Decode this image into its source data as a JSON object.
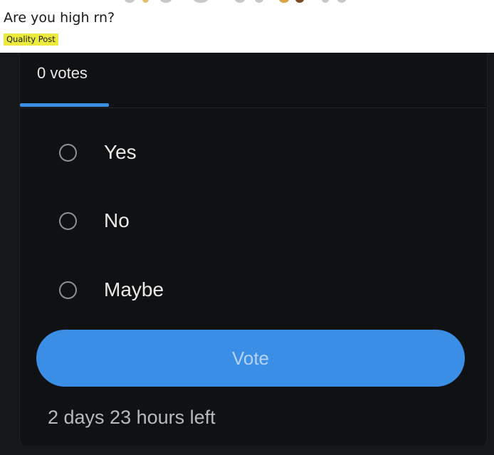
{
  "post": {
    "title": "Are you high rn?",
    "flair": "Quality Post"
  },
  "poll": {
    "tab_label": "0 votes",
    "options": [
      {
        "label": "Yes"
      },
      {
        "label": "No"
      },
      {
        "label": "Maybe"
      }
    ],
    "vote_label": "Vote",
    "time_left": "2 days 23 hours left"
  },
  "colors": {
    "accent": "#3a8ee6",
    "flair_bg": "#ecea3c",
    "card_bg": "#101112"
  }
}
